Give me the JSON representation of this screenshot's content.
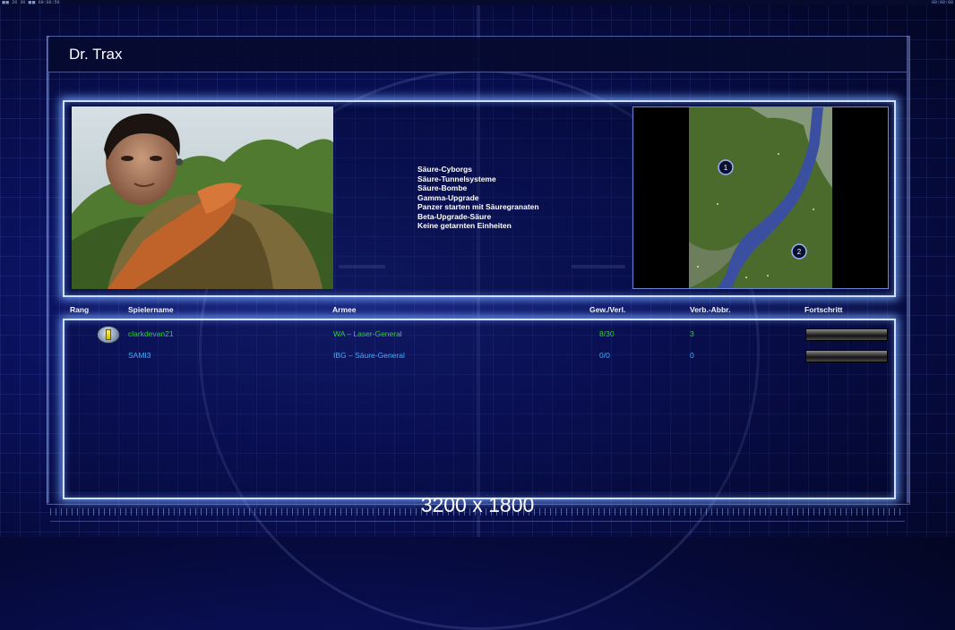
{
  "clock": {
    "left": "◼◼ 20 30 ◼◼ 09:06:56",
    "right": "00:00:00"
  },
  "title": "Dr. Trax",
  "abilities": [
    "Säure-Cyborgs",
    "Säure-Tunnelsysteme",
    "Säure-Bombe",
    "Gamma-Upgrade",
    "Panzer starten mit Säuregranaten",
    "Beta-Upgrade-Säure",
    "Keine getarnten Einheiten"
  ],
  "minimap": {
    "start_markers": [
      "1",
      "2"
    ]
  },
  "table": {
    "headers": {
      "rank": "Rang",
      "player": "Spielername",
      "army": "Armee",
      "winloss": "Gew./Verl.",
      "disconnects": "Verb.-Abbr.",
      "progress": "Fortschritt"
    },
    "rows": [
      {
        "rank_icon": "rank-badge-icon",
        "player": "clarkdevan21",
        "army": "WA – Laser-General",
        "winloss": "8/30",
        "disconnects": "3",
        "progress": 0,
        "color": "#2fd42f"
      },
      {
        "rank_icon": "",
        "player": "SAMI3",
        "army": "IBG – Säure-General",
        "winloss": "0/0",
        "disconnects": "0",
        "progress": 0,
        "color": "#3fb0ff"
      }
    ]
  },
  "resolution_label": "3200 x 1800",
  "colors": {
    "frame_glow": "#cfe0ff",
    "background": "#0b1260"
  }
}
